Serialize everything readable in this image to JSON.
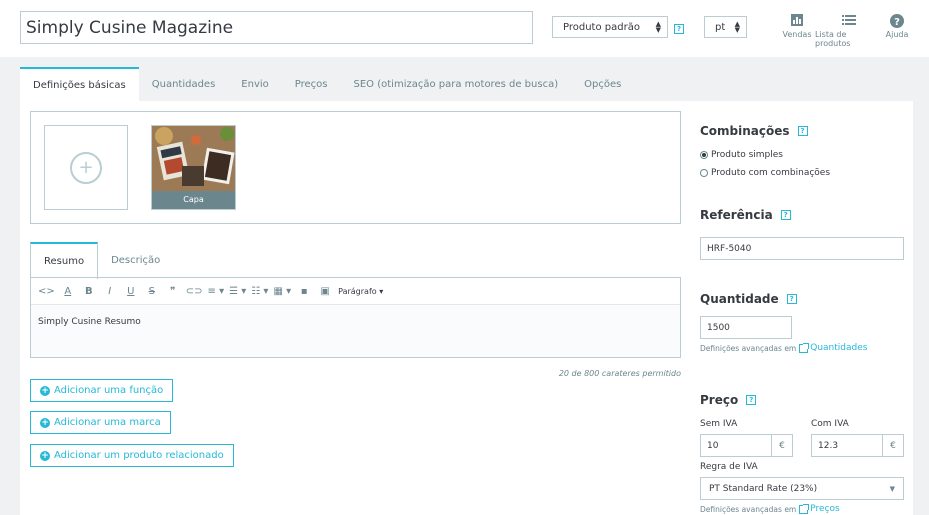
{
  "header": {
    "product_name": "Simply Cusine Magazine",
    "product_type": "Produto padrão",
    "help_mark": "?",
    "language": "pt",
    "links": [
      {
        "label": "Vendas",
        "icon": "bar-chart-icon"
      },
      {
        "label": "Lista de produtos",
        "icon": "list-icon"
      },
      {
        "label": "Ajuda",
        "icon": "help-circle-icon"
      }
    ]
  },
  "tabs": [
    {
      "label": "Definições básicas",
      "active": true
    },
    {
      "label": "Quantidades"
    },
    {
      "label": "Envio"
    },
    {
      "label": "Preços"
    },
    {
      "label": "SEO (otimização para motores de busca)"
    },
    {
      "label": "Opções"
    }
  ],
  "images": {
    "cover_label": "Capa"
  },
  "description": {
    "tabs": [
      {
        "label": "Resumo",
        "active": true
      },
      {
        "label": "Descrição"
      }
    ],
    "toolbar": {
      "paragraph_label": "Parágrafo"
    },
    "summary_text": "Simply Cusine Resumo",
    "char_count": "20 de 800 carateres permitido"
  },
  "buttons": {
    "add_feature": "Adicionar uma função",
    "add_brand": "Adicionar uma marca",
    "add_related": "Adicionar um produto relacionado"
  },
  "combinations": {
    "title": "Combinações",
    "options": [
      {
        "label": "Produto simples",
        "checked": true
      },
      {
        "label": "Produto com combinações",
        "checked": false
      }
    ]
  },
  "reference": {
    "title": "Referência",
    "value": "HRF-5040"
  },
  "quantity": {
    "title": "Quantidade",
    "value": "1500",
    "advanced_note": "Definições avançadas em",
    "advanced_link": "Quantidades"
  },
  "price": {
    "title": "Preço",
    "tax_excl_label": "Sem IVA",
    "tax_excl_value": "10",
    "tax_incl_label": "Com IVA",
    "tax_incl_value": "12.3",
    "currency": "€",
    "tax_rule_label": "Regra de IVA",
    "tax_rule_value": "PT Standard Rate (23%)",
    "advanced_note": "Definições avançadas em",
    "advanced_link": "Preços"
  },
  "colors": {
    "accent": "#25b9d7",
    "text": "#363a41",
    "muted": "#6c868e",
    "border": "#bbcdd2",
    "background": "#eff1f2"
  }
}
